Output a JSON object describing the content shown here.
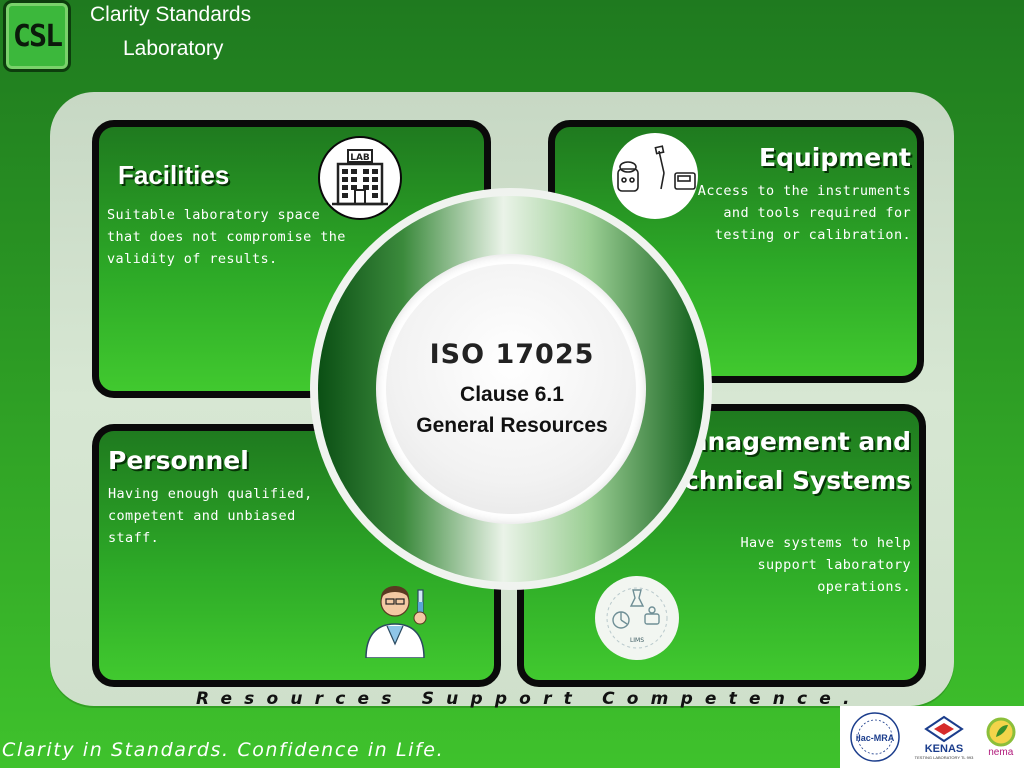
{
  "brand": {
    "logo_text": "CSL",
    "name_line1": "Clarity Standards",
    "name_line2": "Laboratory"
  },
  "center": {
    "standard": "ISO 17025",
    "clause": "Clause 6.1",
    "topic": "General Resources"
  },
  "sections": {
    "facilities": {
      "title": "Facilities",
      "description": "Suitable laboratory space that does not compromise the validity of results.",
      "icon": "lab-building-icon",
      "icon_label": "LAB"
    },
    "equipment": {
      "title": "Equipment",
      "description": "Access to the instruments and tools required for testing or calibration.",
      "icon": "lab-equipment-icon"
    },
    "personnel": {
      "title": "Personnel",
      "description": "Having enough qualified, competent and unbiased staff.",
      "icon": "scientist-icon"
    },
    "management": {
      "title": "Management and Technical Systems",
      "description": "Have systems to help support laboratory operations.",
      "icon": "lims-icon",
      "icon_label": "LIMS"
    }
  },
  "tagline": "Resources Support Competence.",
  "footer": "Clarity in Standards. Confidence in Life.",
  "accreditation": {
    "ilac": "ilac-MRA",
    "kenas": "KENAS",
    "kenas_sub": "TESTING LABORATORY TL 993",
    "nema": "nema"
  },
  "colors": {
    "background_top": "#1f7a1f",
    "background_bottom": "#3fc22c",
    "frame": "#d0e1cc",
    "panel_border": "#0a0a0a"
  }
}
